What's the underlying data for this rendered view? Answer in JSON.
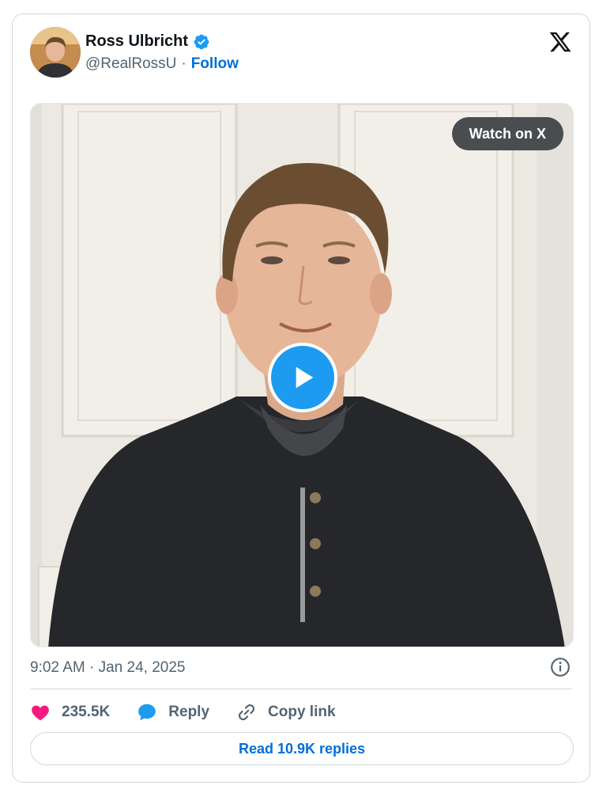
{
  "author": {
    "name": "Ross Ulbricht",
    "handle": "@RealRossU",
    "separator": "·",
    "follow_label": "Follow",
    "verified_icon": "verified-badge-icon",
    "verified_color": "#1d9bf0"
  },
  "media": {
    "watch_label": "Watch on X",
    "play_icon": "play-icon"
  },
  "post": {
    "timestamp": "9:02 AM · Jan 24, 2025",
    "info_icon": "info-icon"
  },
  "actions": {
    "like_count": "235.5K",
    "like_icon": "heart-icon",
    "like_color": "#f91880",
    "reply_label": "Reply",
    "reply_icon": "speech-bubble-icon",
    "copy_label": "Copy link",
    "copy_icon": "link-icon"
  },
  "replies": {
    "read_label": "Read 10.9K replies"
  },
  "colors": {
    "link": "#006fd6",
    "accent": "#1d9bf0",
    "muted": "#536471"
  }
}
